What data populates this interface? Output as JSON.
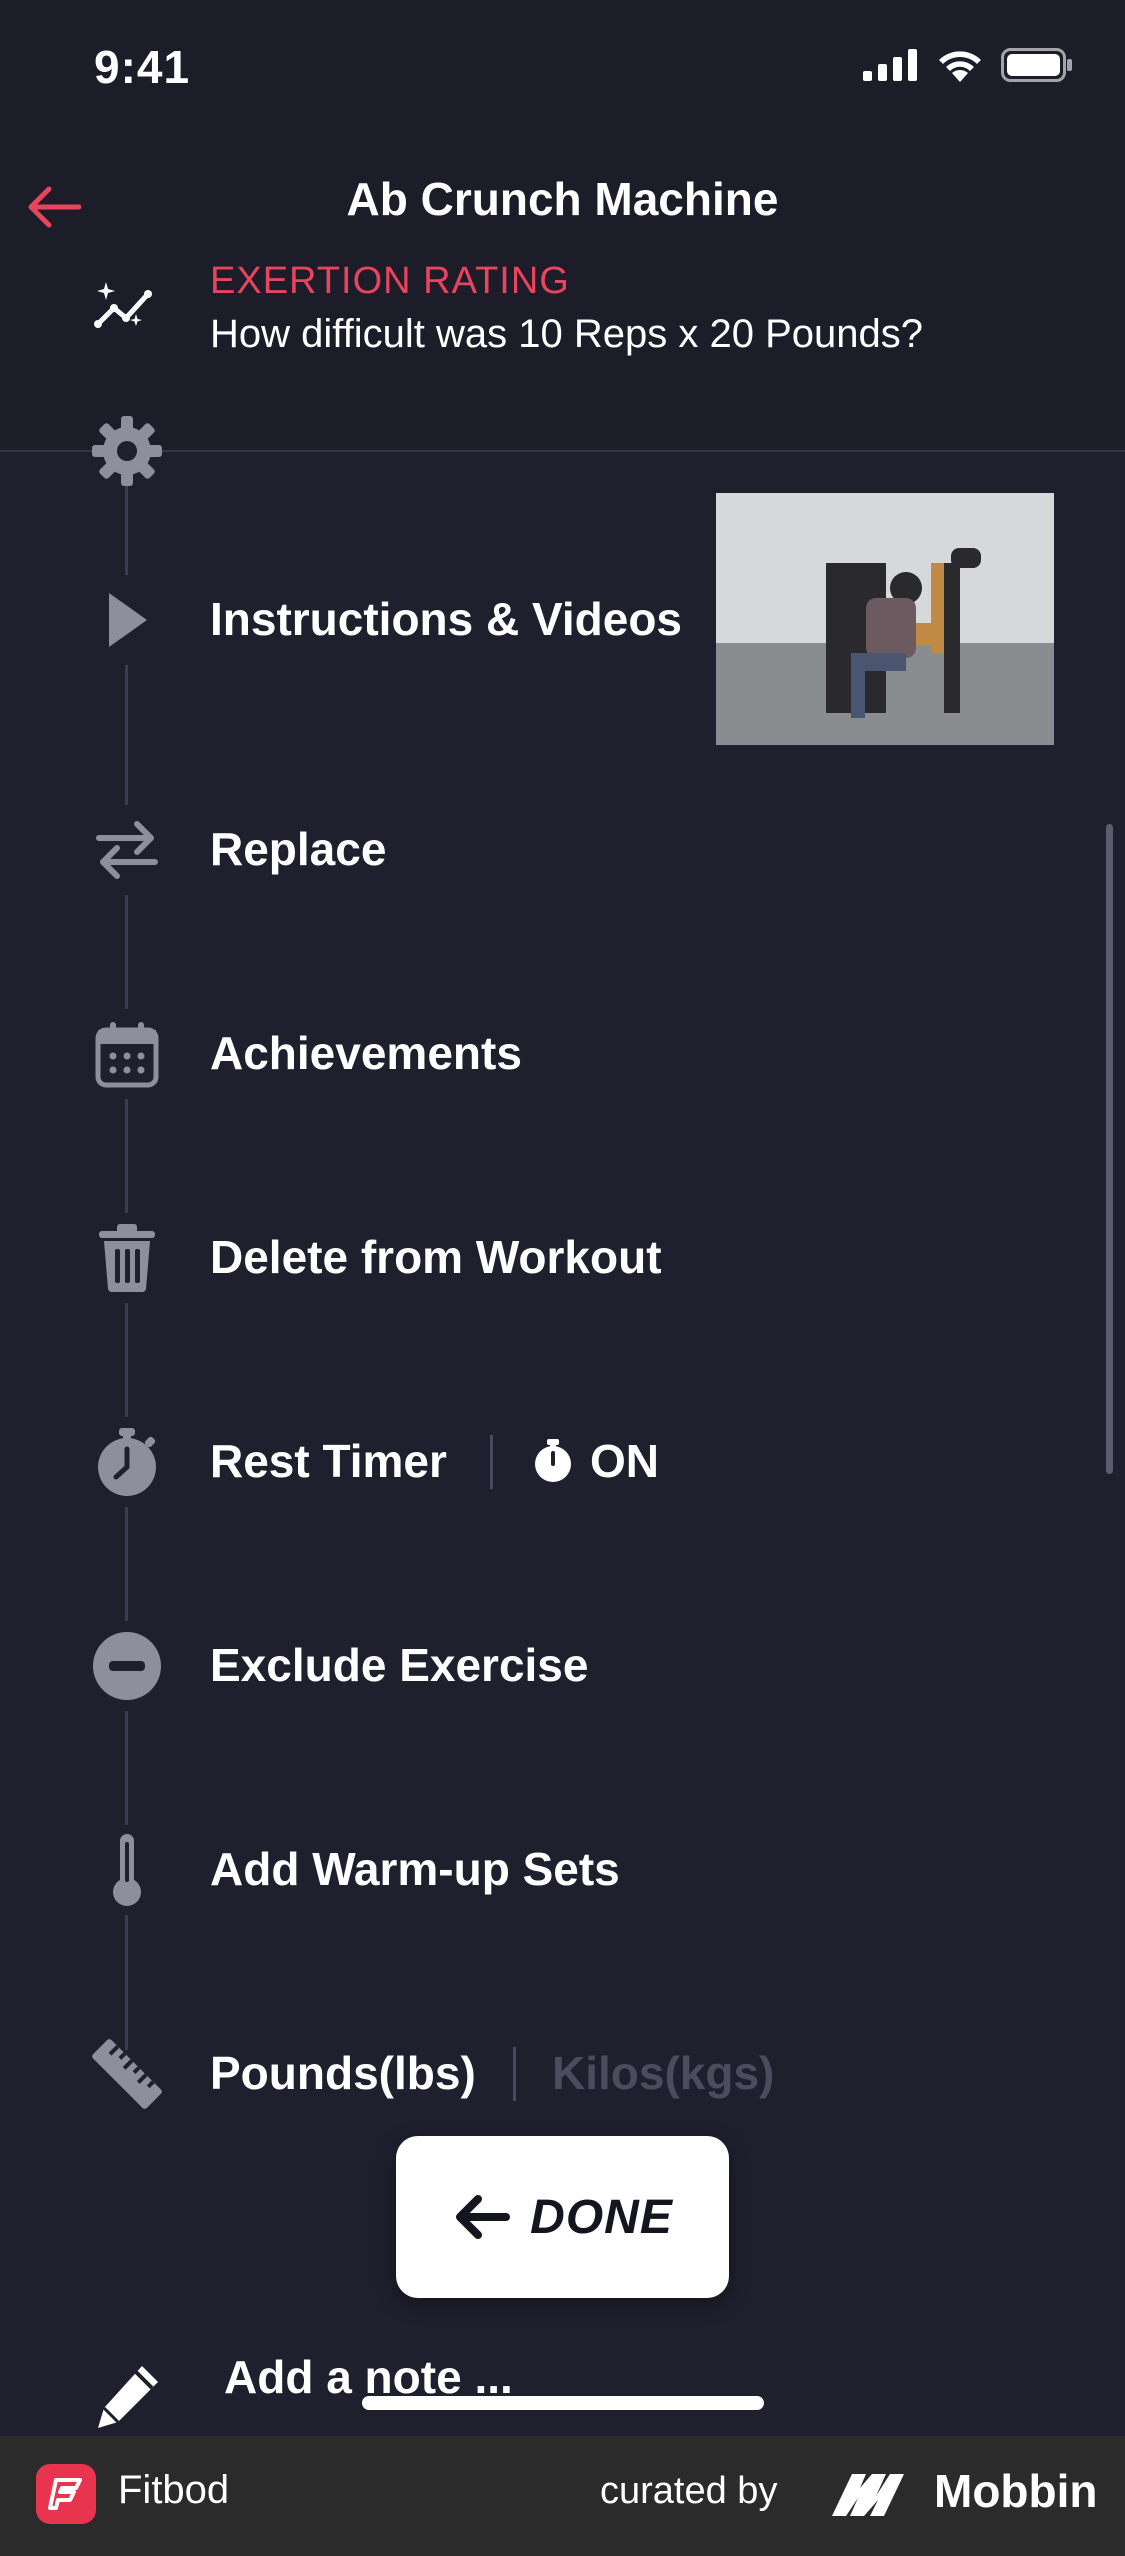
{
  "status_bar": {
    "time": "9:41"
  },
  "header": {
    "title": "Ab Crunch Machine",
    "exertion_label": "EXERTION RATING",
    "exertion_question": "How difficult was 10 Reps x 20 Pounds?"
  },
  "menu": {
    "instructions": "Instructions & Videos",
    "replace": "Replace",
    "achievements": "Achievements",
    "delete": "Delete from Workout",
    "rest_timer": "Rest Timer",
    "rest_timer_state": "ON",
    "exclude": "Exclude Exercise",
    "warmup": "Add Warm-up Sets",
    "units_selected": "Pounds(lbs)",
    "units_other": "Kilos(kgs)"
  },
  "done_button": {
    "label": "DONE"
  },
  "note": {
    "placeholder": "Add a note ..."
  },
  "footer": {
    "app_name": "Fitbod",
    "curated_by": "curated by",
    "brand": "Mobbin"
  },
  "colors": {
    "accent": "#e8445e",
    "background": "#1f1f2e",
    "header_bg": "#1d1d29",
    "icon_gray": "#8e8e9c"
  }
}
